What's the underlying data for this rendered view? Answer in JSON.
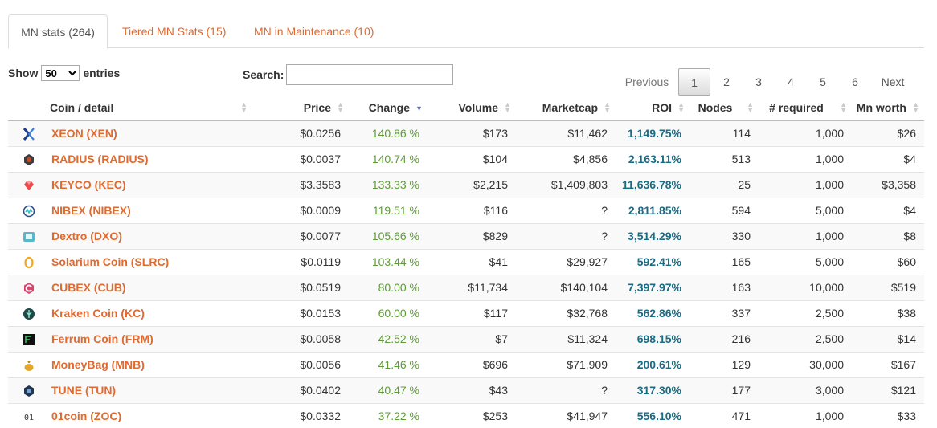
{
  "tabs": [
    {
      "label": "MN stats (264)"
    },
    {
      "label": "Tiered MN Stats (15)"
    },
    {
      "label": "MN in Maintenance (10)"
    }
  ],
  "length": {
    "show": "Show",
    "value": "50",
    "entries": "entries"
  },
  "search": {
    "label": "Search:",
    "value": ""
  },
  "pagination": {
    "previous": "Previous",
    "pages": [
      "1",
      "2",
      "3",
      "4",
      "5",
      "6"
    ],
    "next": "Next",
    "current": "1"
  },
  "columns": [
    "Coin / detail",
    "Price",
    "Change",
    "Volume",
    "Marketcap",
    "ROI",
    "Nodes",
    "# required",
    "Mn worth"
  ],
  "sorted_column": "Change",
  "rows": [
    {
      "icon": "xeon-x-icon",
      "coin": "XEON (XEN)",
      "price": "$0.0256",
      "change": "140.86 %",
      "volume": "$173",
      "marketcap": "$11,462",
      "roi": "1,149.75%",
      "nodes": "114",
      "required": "1,000",
      "worth": "$26"
    },
    {
      "icon": "radius-hex-icon",
      "coin": "RADIUS (RADIUS)",
      "price": "$0.0037",
      "change": "140.74 %",
      "volume": "$104",
      "marketcap": "$4,856",
      "roi": "2,163.11%",
      "nodes": "513",
      "required": "1,000",
      "worth": "$4"
    },
    {
      "icon": "keyco-gem-icon",
      "coin": "KEYCO (KEC)",
      "price": "$3.3583",
      "change": "133.33 %",
      "volume": "$2,215",
      "marketcap": "$1,409,803",
      "roi": "11,636.78%",
      "nodes": "25",
      "required": "1,000",
      "worth": "$3,358"
    },
    {
      "icon": "nibex-circle-icon",
      "coin": "NIBEX (NIBEX)",
      "price": "$0.0009",
      "change": "119.51 %",
      "volume": "$116",
      "marketcap": "?",
      "roi": "2,811.85%",
      "nodes": "594",
      "required": "5,000",
      "worth": "$4"
    },
    {
      "icon": "dextro-square-icon",
      "coin": "Dextro (DXO)",
      "price": "$0.0077",
      "change": "105.66 %",
      "volume": "$829",
      "marketcap": "?",
      "roi": "3,514.29%",
      "nodes": "330",
      "required": "1,000",
      "worth": "$8"
    },
    {
      "icon": "solarium-ring-icon",
      "coin": "Solarium Coin (SLRC)",
      "price": "$0.0119",
      "change": "103.44 %",
      "volume": "$41",
      "marketcap": "$29,927",
      "roi": "592.41%",
      "nodes": "165",
      "required": "5,000",
      "worth": "$60"
    },
    {
      "icon": "cubex-c-icon",
      "coin": "CUBEX (CUB)",
      "price": "$0.0519",
      "change": "80.00 %",
      "volume": "$11,734",
      "marketcap": "$140,104",
      "roi": "7,397.97%",
      "nodes": "163",
      "required": "10,000",
      "worth": "$519"
    },
    {
      "icon": "kraken-circle-icon",
      "coin": "Kraken Coin (KC)",
      "price": "$0.0153",
      "change": "60.00 %",
      "volume": "$117",
      "marketcap": "$32,768",
      "roi": "562.86%",
      "nodes": "337",
      "required": "2,500",
      "worth": "$38"
    },
    {
      "icon": "ferrum-square-icon",
      "coin": "Ferrum Coin (FRM)",
      "price": "$0.0058",
      "change": "42.52 %",
      "volume": "$7",
      "marketcap": "$11,324",
      "roi": "698.15%",
      "nodes": "216",
      "required": "2,500",
      "worth": "$14"
    },
    {
      "icon": "moneybag-icon",
      "coin": "MoneyBag (MNB)",
      "price": "$0.0056",
      "change": "41.46 %",
      "volume": "$696",
      "marketcap": "$71,909",
      "roi": "200.61%",
      "nodes": "129",
      "required": "30,000",
      "worth": "$167"
    },
    {
      "icon": "tune-hex-icon",
      "coin": "TUNE (TUN)",
      "price": "$0.0402",
      "change": "40.47 %",
      "volume": "$43",
      "marketcap": "?",
      "roi": "317.30%",
      "nodes": "177",
      "required": "3,000",
      "worth": "$121"
    },
    {
      "icon": "01coin-text-icon",
      "coin": "01coin (ZOC)",
      "price": "$0.0332",
      "change": "37.22 %",
      "volume": "$253",
      "marketcap": "$41,947",
      "roi": "556.10%",
      "nodes": "471",
      "required": "1,000",
      "worth": "$33"
    }
  ],
  "colors": {
    "link": "#e06a2f",
    "change": "#5e9a3a",
    "roi": "#1c6b84",
    "sort_active": "#5b6eb6"
  }
}
